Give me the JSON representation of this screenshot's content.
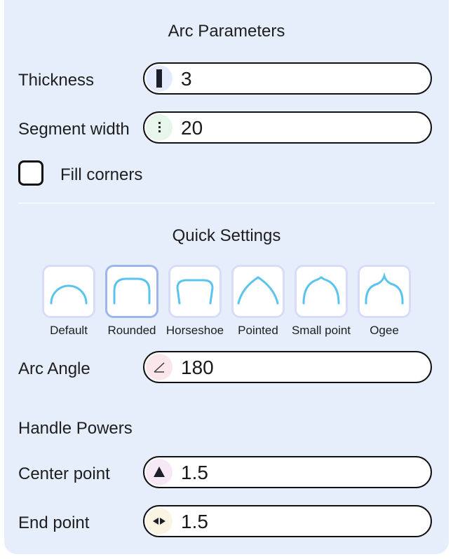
{
  "arc_parameters": {
    "title": "Arc Parameters",
    "thickness": {
      "label": "Thickness",
      "value": "3",
      "icon": "thickness-bar-icon"
    },
    "segment_width": {
      "label": "Segment width",
      "value": "20",
      "icon": "dotted-line-icon"
    },
    "fill_corners": {
      "label": "Fill corners",
      "checked": false
    }
  },
  "quick_settings": {
    "title": "Quick Settings",
    "selected": "Rounded",
    "presets": [
      {
        "label": "Default",
        "icon": "arc-default-icon"
      },
      {
        "label": "Rounded",
        "icon": "arc-rounded-icon"
      },
      {
        "label": "Horseshoe",
        "icon": "arc-horseshoe-icon"
      },
      {
        "label": "Pointed",
        "icon": "arc-pointed-icon"
      },
      {
        "label": "Small point",
        "icon": "arc-small-point-icon"
      },
      {
        "label": "Ogee",
        "icon": "arc-ogee-icon"
      }
    ],
    "arc_angle": {
      "label": "Arc Angle",
      "value": "180",
      "icon": "angle-icon"
    }
  },
  "handle_powers": {
    "title": "Handle Powers",
    "center_point": {
      "label": "Center point",
      "value": "1.5",
      "icon": "triangle-up-icon"
    },
    "end_point": {
      "label": "End point",
      "value": "1.5",
      "icon": "left-right-arrows-icon"
    }
  },
  "colors": {
    "panel_bg": "#e6edfb",
    "arc_stroke": "#5bc4ee",
    "preset_border": "#d9dcf8",
    "preset_selected_border": "#9db4ec"
  }
}
